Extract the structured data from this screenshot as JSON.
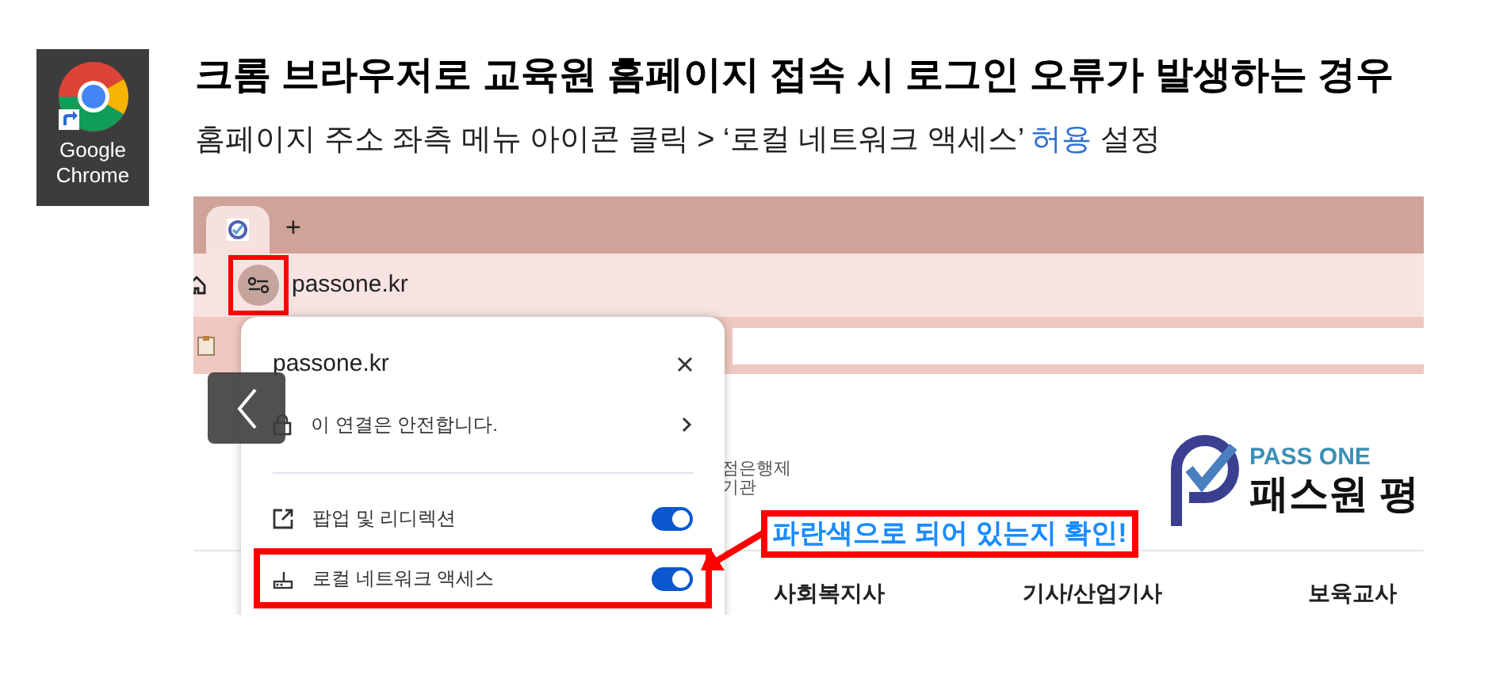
{
  "desktop_icon": {
    "label": "Google Chrome"
  },
  "heading": {
    "title": "크롬 브라우저로 교육원 홈페이지 접속 시 로그인 오류가 발생하는 경우",
    "subtitle": [
      {
        "text": "홈페이지 주소 좌측 메뉴 아이콘 클릭 > ‘로컬 네트워크 액세스’ ",
        "highlight": false
      },
      {
        "text": "허용",
        "highlight": true
      },
      {
        "text": " 설정",
        "highlight": false
      }
    ]
  },
  "browser": {
    "new_tab": "+",
    "address": "passone.kr",
    "site_button_highlighted": true
  },
  "site_panel": {
    "site": "passone.kr",
    "connection": "이 연결은 안전합니다.",
    "permissions": [
      {
        "kind": "popup",
        "label": "팝업 및 리디렉션",
        "on": true,
        "highlighted": false
      },
      {
        "kind": "network",
        "label": "로컬 네트워크 액세스",
        "on": true,
        "highlighted": true
      }
    ]
  },
  "page": {
    "side_text": [
      "점은행제",
      "기관"
    ],
    "logo": {
      "tagline": "PASS ONE",
      "name": "패스원 평"
    },
    "nav": [
      "사회복지사",
      "기사/산업기사",
      "보육교사"
    ]
  },
  "callout": {
    "text": "파란색으로 되어 있는지 확인!"
  }
}
